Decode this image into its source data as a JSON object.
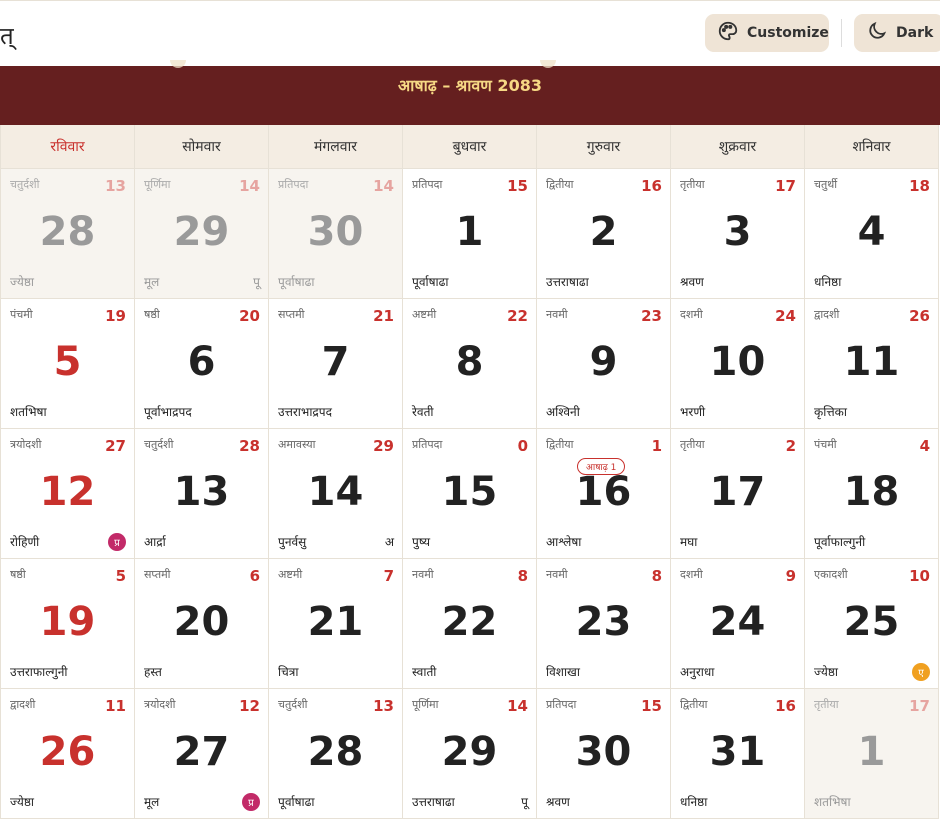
{
  "topbar": {
    "left_glyph": "त्",
    "customize_label": "Customize",
    "dark_label": "Dark",
    "icons": [
      "palette-icon",
      "moon-icon"
    ]
  },
  "banner": {
    "subtitle": "आषाढ़ – श्रावण 2083"
  },
  "weekdays": [
    "रविवार",
    "सोमवार",
    "मंगलवार",
    "बुधवार",
    "गुरुवार",
    "शुक्रवार",
    "शनिवार"
  ],
  "colors": {
    "accent_red": "#c8312d",
    "banner_bg": "#651f1f",
    "banner_text": "#f6d884",
    "button_bg": "#efe4d6"
  },
  "days": [
    {
      "tithi": "चतुर्दशी",
      "hnum": "13",
      "day": "28",
      "nak": "ज्येष्ठा",
      "corner": "",
      "badge": "",
      "pill": "",
      "other": true
    },
    {
      "tithi": "पूर्णिमा",
      "hnum": "14",
      "day": "29",
      "nak": "मूल",
      "corner": "पू",
      "badge": "",
      "pill": "",
      "other": true
    },
    {
      "tithi": "प्रतिपदा",
      "hnum": "14",
      "day": "30",
      "nak": "पूर्वाषाढा",
      "corner": "",
      "badge": "",
      "pill": "",
      "other": true
    },
    {
      "tithi": "प्रतिपदा",
      "hnum": "15",
      "day": "1",
      "nak": "पूर्वाषाढा",
      "corner": "",
      "badge": "",
      "pill": "",
      "other": false
    },
    {
      "tithi": "द्वितीया",
      "hnum": "16",
      "day": "2",
      "nak": "उत्तराषाढा",
      "corner": "",
      "badge": "",
      "pill": "",
      "other": false
    },
    {
      "tithi": "तृतीया",
      "hnum": "17",
      "day": "3",
      "nak": "श्रवण",
      "corner": "",
      "badge": "",
      "pill": "",
      "other": false
    },
    {
      "tithi": "चतुर्थी",
      "hnum": "18",
      "day": "4",
      "nak": "धनिष्ठा",
      "corner": "",
      "badge": "",
      "pill": "",
      "other": false
    },
    {
      "tithi": "पंचमी",
      "hnum": "19",
      "day": "5",
      "nak": "शतभिषा",
      "corner": "",
      "badge": "",
      "pill": "",
      "other": false
    },
    {
      "tithi": "षष्ठी",
      "hnum": "20",
      "day": "6",
      "nak": "पूर्वाभाद्रपद",
      "corner": "",
      "badge": "",
      "pill": "",
      "other": false
    },
    {
      "tithi": "सप्तमी",
      "hnum": "21",
      "day": "7",
      "nak": "उत्तराभाद्रपद",
      "corner": "",
      "badge": "",
      "pill": "",
      "other": false
    },
    {
      "tithi": "अष्टमी",
      "hnum": "22",
      "day": "8",
      "nak": "रेवती",
      "corner": "",
      "badge": "",
      "pill": "",
      "other": false
    },
    {
      "tithi": "नवमी",
      "hnum": "23",
      "day": "9",
      "nak": "अश्विनी",
      "corner": "",
      "badge": "",
      "pill": "",
      "other": false
    },
    {
      "tithi": "दशमी",
      "hnum": "24",
      "day": "10",
      "nak": "भरणी",
      "corner": "",
      "badge": "",
      "pill": "",
      "other": false
    },
    {
      "tithi": "द्वादशी",
      "hnum": "26",
      "day": "11",
      "nak": "कृत्तिका",
      "corner": "",
      "badge": "",
      "pill": "",
      "other": false
    },
    {
      "tithi": "त्रयोदशी",
      "hnum": "27",
      "day": "12",
      "nak": "रोहिणी",
      "corner": "",
      "badge": "प्र",
      "pill": "",
      "other": false
    },
    {
      "tithi": "चतुर्दशी",
      "hnum": "28",
      "day": "13",
      "nak": "आर्द्रा",
      "corner": "",
      "badge": "",
      "pill": "",
      "other": false
    },
    {
      "tithi": "अमावस्या",
      "hnum": "29",
      "day": "14",
      "nak": "पुनर्वसु",
      "corner": "अ",
      "badge": "",
      "pill": "",
      "other": false
    },
    {
      "tithi": "प्रतिपदा",
      "hnum": "0",
      "day": "15",
      "nak": "पुष्य",
      "corner": "",
      "badge": "",
      "pill": "",
      "other": false
    },
    {
      "tithi": "द्वितीया",
      "hnum": "1",
      "day": "16",
      "nak": "आश्लेषा",
      "corner": "",
      "badge": "",
      "pill": "आषाढ़ 1",
      "other": false
    },
    {
      "tithi": "तृतीया",
      "hnum": "2",
      "day": "17",
      "nak": "मघा",
      "corner": "",
      "badge": "",
      "pill": "",
      "other": false
    },
    {
      "tithi": "पंचमी",
      "hnum": "4",
      "day": "18",
      "nak": "पूर्वाफाल्गुनी",
      "corner": "",
      "badge": "",
      "pill": "",
      "other": false
    },
    {
      "tithi": "षष्ठी",
      "hnum": "5",
      "day": "19",
      "nak": "उत्तराफाल्गुनी",
      "corner": "",
      "badge": "",
      "pill": "",
      "other": false
    },
    {
      "tithi": "सप्तमी",
      "hnum": "6",
      "day": "20",
      "nak": "हस्त",
      "corner": "",
      "badge": "",
      "pill": "",
      "other": false
    },
    {
      "tithi": "अष्टमी",
      "hnum": "7",
      "day": "21",
      "nak": "चित्रा",
      "corner": "",
      "badge": "",
      "pill": "",
      "other": false
    },
    {
      "tithi": "नवमी",
      "hnum": "8",
      "day": "22",
      "nak": "स्वाती",
      "corner": "",
      "badge": "",
      "pill": "",
      "other": false
    },
    {
      "tithi": "नवमी",
      "hnum": "8",
      "day": "23",
      "nak": "विशाखा",
      "corner": "",
      "badge": "",
      "pill": "",
      "other": false
    },
    {
      "tithi": "दशमी",
      "hnum": "9",
      "day": "24",
      "nak": "अनुराधा",
      "corner": "",
      "badge": "",
      "pill": "",
      "other": false
    },
    {
      "tithi": "एकादशी",
      "hnum": "10",
      "day": "25",
      "nak": "ज्येष्ठा",
      "corner": "",
      "badge": "ए",
      "pill": "",
      "other": false
    },
    {
      "tithi": "द्वादशी",
      "hnum": "11",
      "day": "26",
      "nak": "ज्येष्ठा",
      "corner": "",
      "badge": "",
      "pill": "",
      "other": false
    },
    {
      "tithi": "त्रयोदशी",
      "hnum": "12",
      "day": "27",
      "nak": "मूल",
      "corner": "",
      "badge": "प्र",
      "pill": "",
      "other": false
    },
    {
      "tithi": "चतुर्दशी",
      "hnum": "13",
      "day": "28",
      "nak": "पूर्वाषाढा",
      "corner": "",
      "badge": "",
      "pill": "",
      "other": false
    },
    {
      "tithi": "पूर्णिमा",
      "hnum": "14",
      "day": "29",
      "nak": "उत्तराषाढा",
      "corner": "पू",
      "badge": "",
      "pill": "",
      "other": false
    },
    {
      "tithi": "प्रतिपदा",
      "hnum": "15",
      "day": "30",
      "nak": "श्रवण",
      "corner": "",
      "badge": "",
      "pill": "",
      "other": false
    },
    {
      "tithi": "द्वितीया",
      "hnum": "16",
      "day": "31",
      "nak": "धनिष्ठा",
      "corner": "",
      "badge": "",
      "pill": "",
      "other": false
    },
    {
      "tithi": "तृतीया",
      "hnum": "17",
      "day": "1",
      "nak": "शतभिषा",
      "corner": "",
      "badge": "",
      "pill": "",
      "other": true
    }
  ]
}
